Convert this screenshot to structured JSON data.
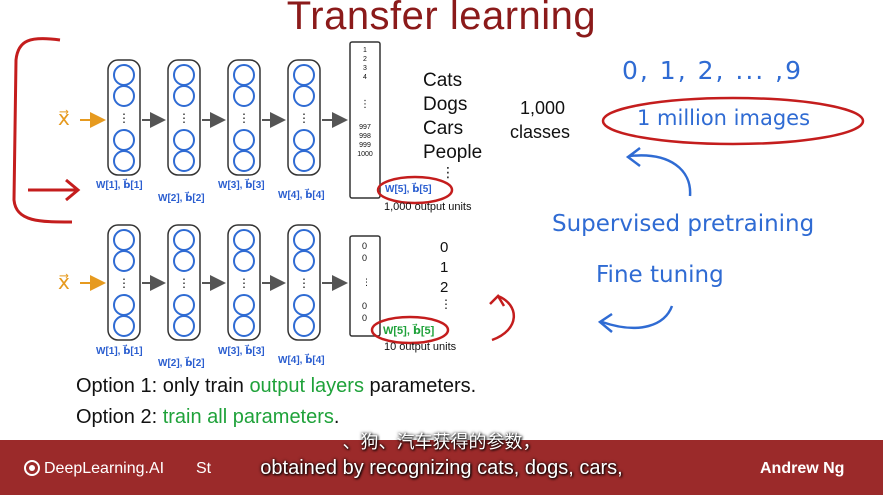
{
  "slide": {
    "title": "Transfer learning",
    "network": {
      "input_label": "x⃗",
      "top_output": {
        "labels": [
          "1",
          "2",
          "3",
          "4",
          "⋮",
          "997",
          "998",
          "999",
          "1000"
        ],
        "units_caption": "1,000 output units",
        "w5": "W[5], b⃗[5]"
      },
      "bottom_output": {
        "labels": [
          "0",
          "0",
          "⋮",
          "0",
          "0"
        ],
        "units_caption": "10 output units",
        "w5": "W[5], b⃗[5]"
      },
      "layer_weights": {
        "w1": "W[1], b⃗[1]",
        "w2": "W[2], b⃗[2]",
        "w3": "W[3], b⃗[3]",
        "w4": "W[4], b⃗[4]"
      }
    },
    "class_list": [
      "Cats",
      "Dogs",
      "Cars",
      "People",
      "⋮"
    ],
    "classes_count": "1,000",
    "classes_word": "classes",
    "digit_list": [
      "0",
      "1",
      "2",
      "⋮"
    ],
    "handwritten": {
      "digits": "0, 1, 2, ... ,9",
      "million": "1 million images",
      "supervised": "Supervised pretraining",
      "finetune": "Fine tuning"
    },
    "options": {
      "opt1_prefix": "Option 1: only train ",
      "opt1_green": "output layers",
      "opt1_suffix": " parameters.",
      "opt2_prefix": "Option 2: ",
      "opt2_green": "train all parameters",
      "opt2_suffix": "."
    }
  },
  "footer": {
    "brand": "DeepLearning.AI",
    "course": "St",
    "author": "Andrew Ng",
    "subtitle_cn": "、狗、汽车获得的参数，",
    "subtitle_en": "obtained by recognizing cats, dogs, cars,"
  },
  "colors": {
    "title": "#8b1a1a",
    "handwriting_blue": "#2f6bd3",
    "handwriting_red": "#c41d1d",
    "highlight_green": "#1fa23a",
    "footer_bg": "#9b2a2a"
  }
}
